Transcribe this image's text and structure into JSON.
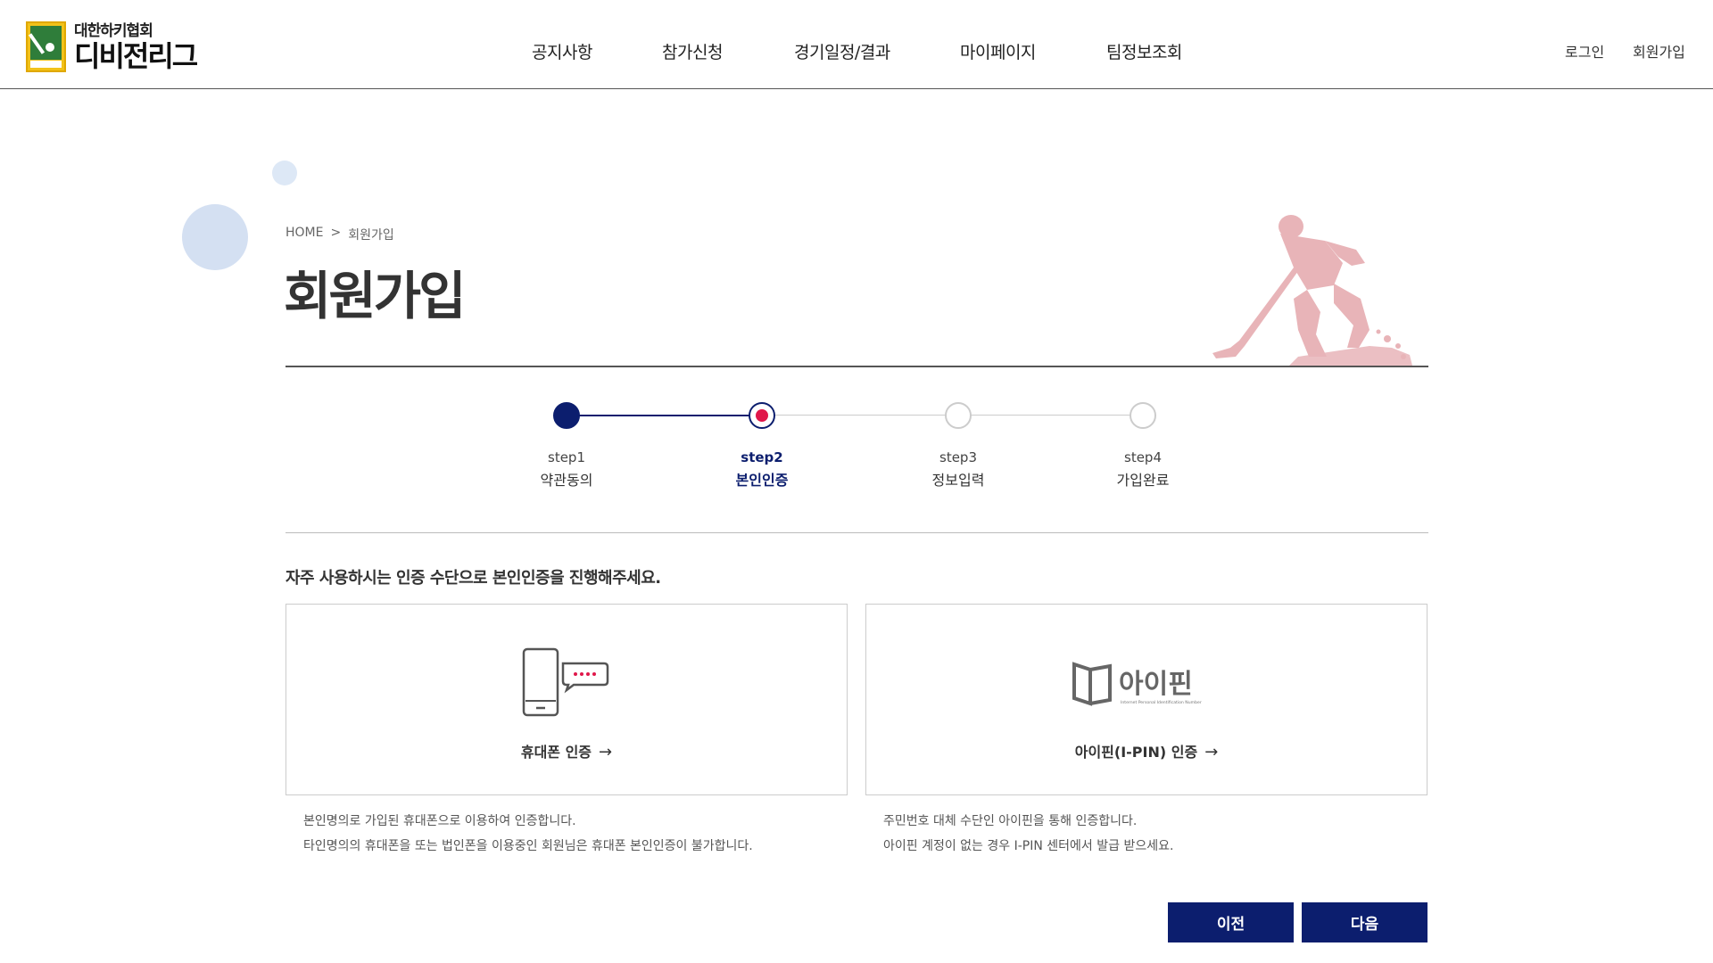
{
  "header": {
    "logo": {
      "sub": "대한하키협회",
      "main": "디비전리그",
      "badge_text": "대한하키협회"
    },
    "nav": [
      "공지사항",
      "참가신청",
      "경기일정/결과",
      "마이페이지",
      "팀정보조회"
    ],
    "util": {
      "login": "로그인",
      "signup": "회원가입"
    }
  },
  "breadcrumb": {
    "home": "HOME",
    "separator": ">",
    "current": "회원가입"
  },
  "page_title": "회원가입",
  "steps": [
    {
      "step": "step1",
      "name": "약관동의",
      "state": "done"
    },
    {
      "step": "step2",
      "name": "본인인증",
      "state": "current"
    },
    {
      "step": "step3",
      "name": "정보입력",
      "state": "todo"
    },
    {
      "step": "step4",
      "name": "가입완료",
      "state": "todo"
    }
  ],
  "intro": "자주 사용하시는 인증 수단으로 본인인증을 진행해주세요.",
  "auth": {
    "phone": {
      "label": "휴대폰 인증",
      "icon": "smartphone-message-icon",
      "desc": [
        "본인명의로 가입된 휴대폰으로 이용하여 인증합니다.",
        "타인명의의 휴대폰을 또는 법인폰을 이용중인 회원님은 휴대폰 본인인증이 불가합니다."
      ]
    },
    "ipin": {
      "label": "아이핀(I-PIN) 인증",
      "icon": "ipin-logo-icon",
      "logo_text": "아이핀",
      "logo_sub": "Internet Personal Identification Number",
      "desc": [
        "주민번호 대체 수단인 아이핀을 통해 인증합니다.",
        "아이핀 계정이 없는 경우 I-PIN 센터에서 발급 받으세요."
      ]
    },
    "arrow": "→"
  },
  "buttons": {
    "prev": "이전",
    "next": "다음"
  },
  "colors": {
    "primary": "#0c1e6e",
    "current_dot": "#e0174a",
    "deco_circle": "#d4e0f2",
    "player_silhouette": "#e8b4b8"
  }
}
